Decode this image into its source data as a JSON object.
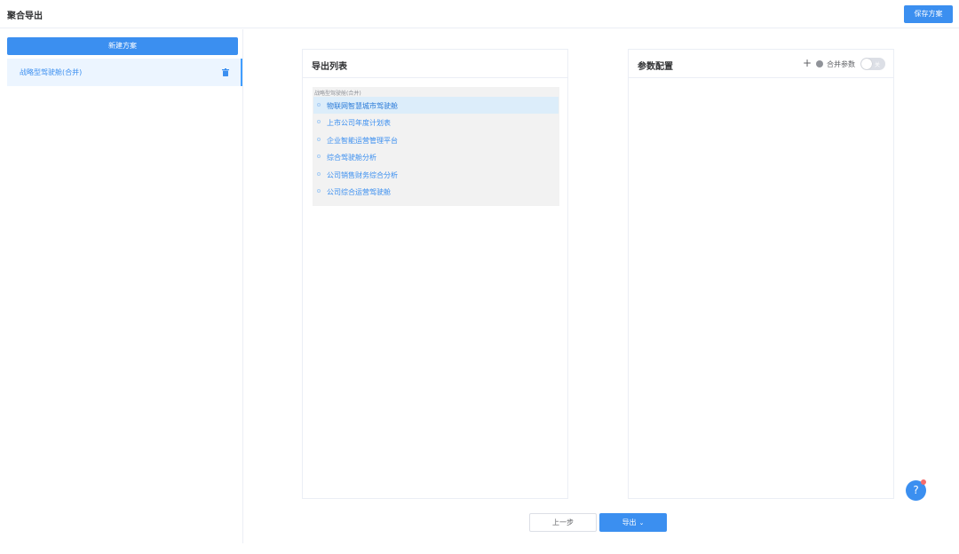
{
  "header": {
    "title": "聚合导出",
    "save_label": "保存方案"
  },
  "sidebar": {
    "new_plan_label": "新建方案",
    "plans": [
      {
        "label": "战略型驾驶舱(合并)"
      }
    ]
  },
  "export_list": {
    "title": "导出列表",
    "group_label": "战略型驾驶舱(合并)",
    "items": [
      {
        "label": "物联网智慧城市驾驶舱"
      },
      {
        "label": "上市公司年度计划表"
      },
      {
        "label": "企业智能运营管理平台"
      },
      {
        "label": "综合驾驶舱分析"
      },
      {
        "label": "公司销售财务综合分析"
      },
      {
        "label": "公司综合运营驾驶舱"
      }
    ]
  },
  "params": {
    "title": "参数配置",
    "merge_label": "合并参数",
    "toggle_text": "关"
  },
  "footer": {
    "prev_label": "上一步",
    "export_label": "导出"
  },
  "help": {
    "label": "?"
  },
  "colors": {
    "primary": "#3b8ff0",
    "active_bg": "#dcedfa",
    "badge": "#f56c6c"
  }
}
